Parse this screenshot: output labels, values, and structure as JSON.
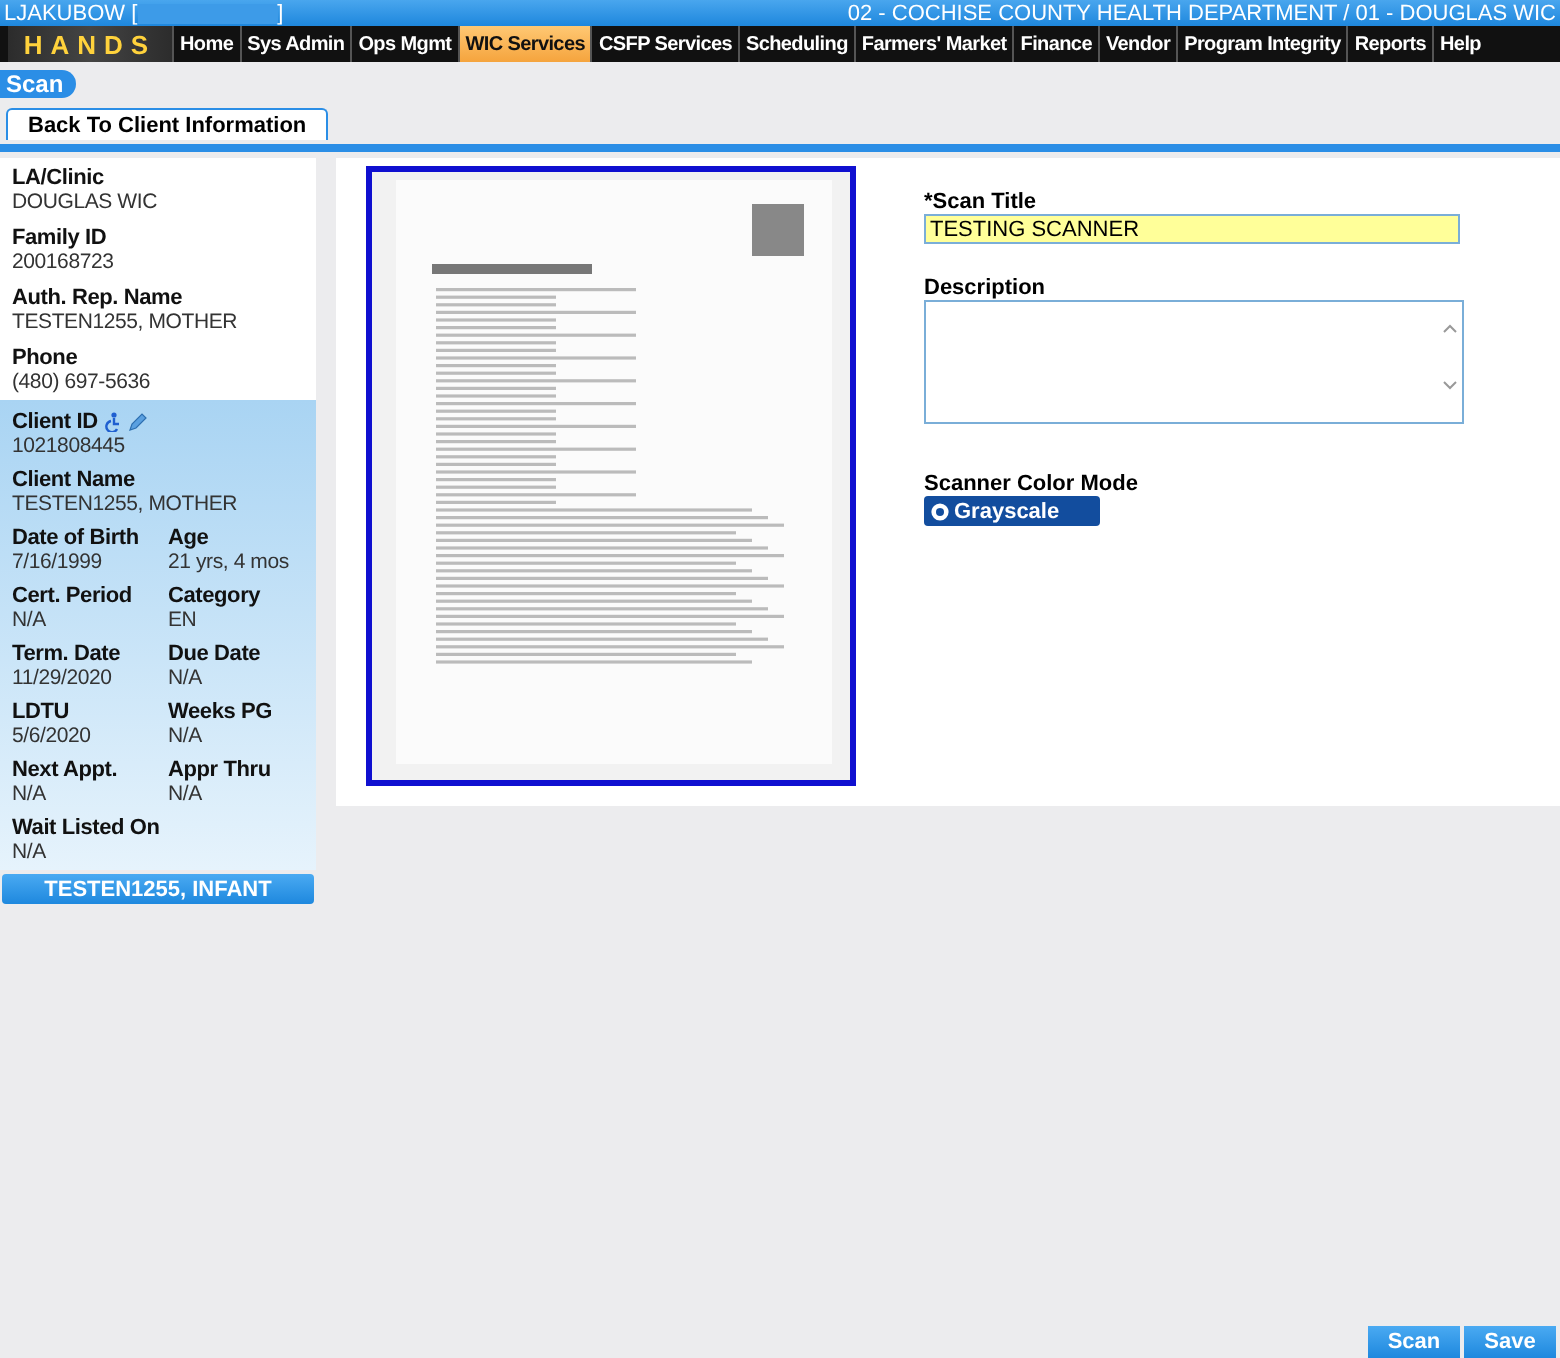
{
  "header": {
    "user": "LJAKUBOW [",
    "user_end": "]",
    "agency": "02 - COCHISE COUNTY HEALTH DEPARTMENT / 01 - DOUGLAS WIC",
    "logo": "HANDS"
  },
  "nav": [
    {
      "label": "Home",
      "selected": false
    },
    {
      "label": "Sys Admin",
      "selected": false
    },
    {
      "label": "Ops Mgmt",
      "selected": false
    },
    {
      "label": "WIC Services",
      "selected": true
    },
    {
      "label": "CSFP Services",
      "selected": false
    },
    {
      "label": "Scheduling",
      "selected": false
    },
    {
      "label": "Farmers' Market",
      "selected": false
    },
    {
      "label": "Finance",
      "selected": false
    },
    {
      "label": "Vendor",
      "selected": false
    },
    {
      "label": "Program Integrity",
      "selected": false
    },
    {
      "label": "Reports",
      "selected": false
    },
    {
      "label": "Help",
      "selected": false
    }
  ],
  "page_title": "Scan",
  "back_tab": "Back To Client Information",
  "family": [
    {
      "label": "LA/Clinic",
      "value": "DOUGLAS WIC"
    },
    {
      "label": "Family ID",
      "value": "200168723"
    },
    {
      "label": "Auth. Rep. Name",
      "value": "TESTEN1255, MOTHER"
    },
    {
      "label": "Phone",
      "value": "(480) 697-5636"
    }
  ],
  "client": [
    [
      {
        "label": "Client ID",
        "value": "1021808445",
        "kind": "id"
      }
    ],
    [
      {
        "label": "Client Name",
        "value": "TESTEN1255, MOTHER",
        "kind": "plain"
      }
    ],
    [
      {
        "label": "Date of Birth",
        "value": "7/16/1999",
        "kind": "plain"
      },
      {
        "label": "Age",
        "value": "21 yrs, 4 mos",
        "kind": "plain"
      }
    ],
    [
      {
        "label": "Cert. Period",
        "value": "N/A",
        "kind": "plain"
      },
      {
        "label": "Category",
        "value": "EN",
        "kind": "plain"
      }
    ],
    [
      {
        "label": "Term. Date",
        "value": "11/29/2020",
        "kind": "plain"
      },
      {
        "label": "Due Date",
        "value": "N/A",
        "kind": "plain"
      }
    ],
    [
      {
        "label": "LDTU",
        "value": "5/6/2020",
        "kind": "plain"
      },
      {
        "label": "Weeks PG",
        "value": "N/A",
        "kind": "plain"
      }
    ],
    [
      {
        "label": "Next Appt.",
        "value": "N/A",
        "kind": "plain"
      },
      {
        "label": "Appr Thru",
        "value": "N/A",
        "kind": "plain"
      }
    ],
    [
      {
        "label": "Wait Listed On",
        "value": "N/A",
        "kind": "plain"
      }
    ]
  ],
  "family_members": [
    {
      "label": "TESTEN1255, INFANT"
    }
  ],
  "form": {
    "title_label": "*Scan Title",
    "title_value": "TESTING SCANNER",
    "description_label": "Description",
    "color_mode_label": "Scanner Color Mode",
    "color_mode": {
      "label": "Grayscale",
      "selected": true
    }
  },
  "buttons": [
    "Scan",
    "Save"
  ]
}
